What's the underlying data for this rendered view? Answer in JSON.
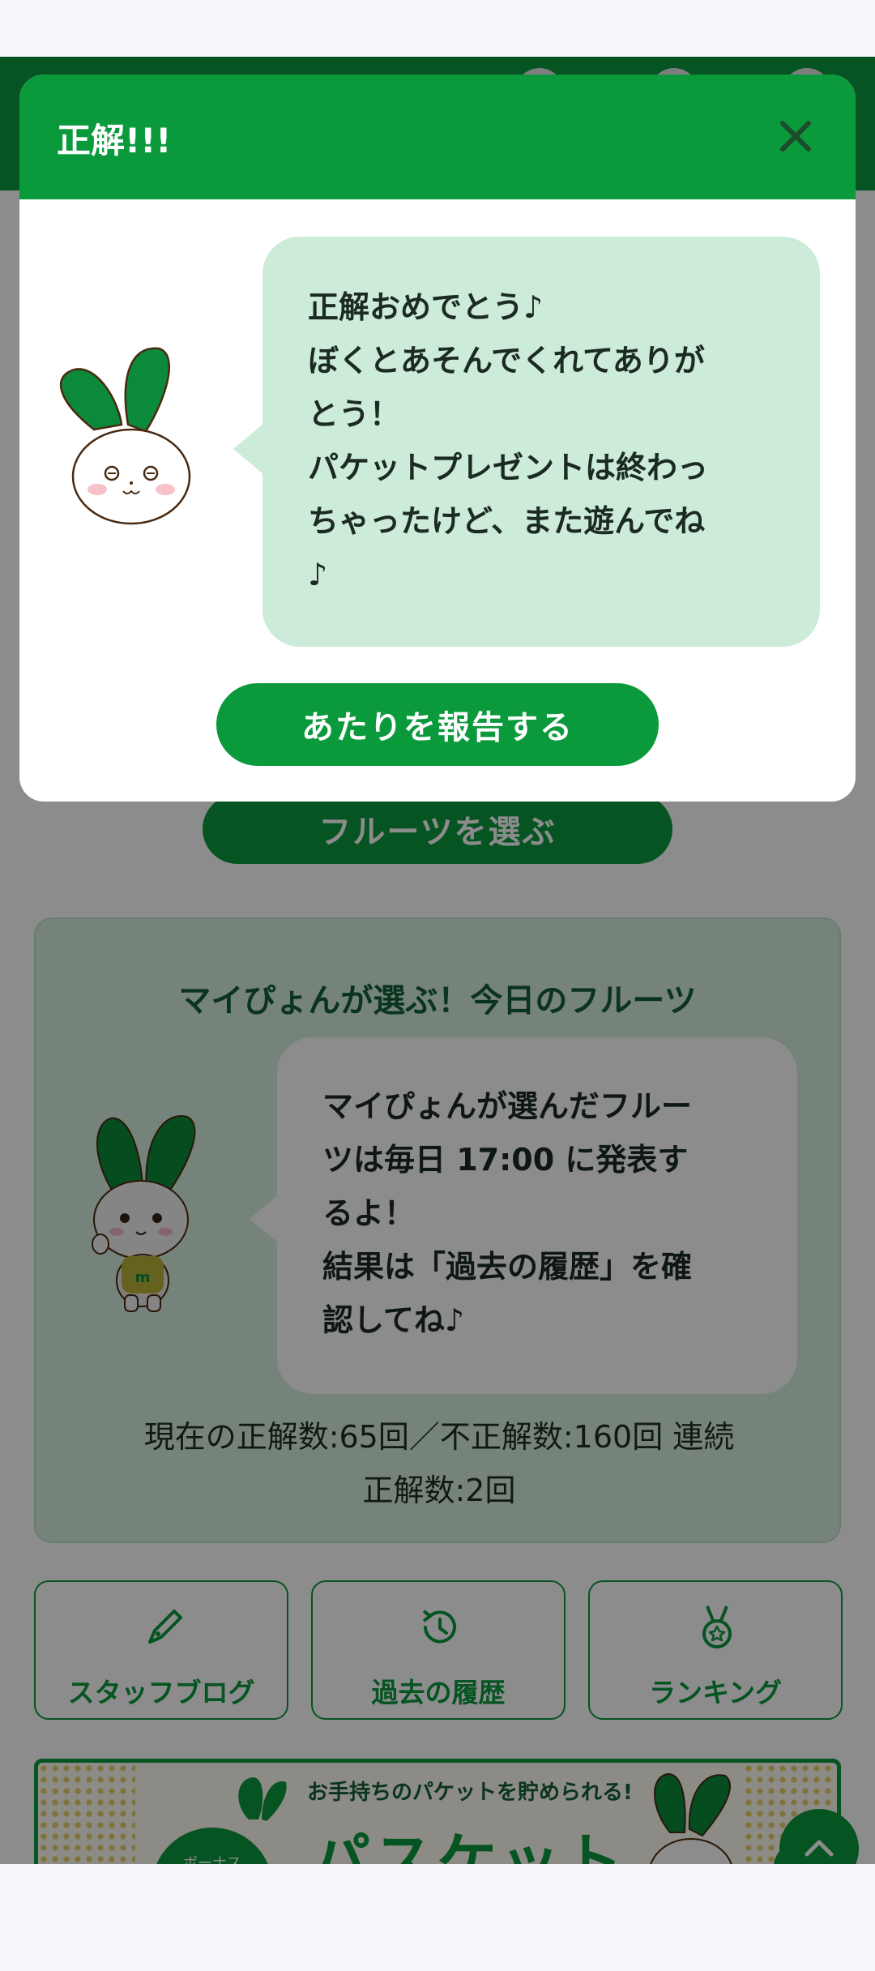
{
  "background_page": {
    "choose_button": "フルーツを選ぶ",
    "pick_card": {
      "title": "マイぴょんが選ぶ！今日のフルーツ",
      "bubble_lines": [
        "マイぴょんが選んだフルー",
        "ツは毎日 17:00 に発表す",
        "るよ！",
        "結果は「過去の履歴」を確",
        "認してね♪"
      ],
      "stats_lines": [
        "現在の正解数:65回／不正解数:160回 連続",
        "正解数:2回"
      ]
    },
    "menu": [
      {
        "label": "スタッフブログ",
        "icon": "pen-icon"
      },
      {
        "label": "過去の履歴",
        "icon": "history-icon"
      },
      {
        "label": "ランキング",
        "icon": "medal-icon"
      }
    ],
    "banner": {
      "subtitle": "お手持ちのパケットを貯められる!",
      "title": "パスケット",
      "bonus_text": "ボーナス"
    }
  },
  "modal": {
    "title": "正解!!!",
    "bubble_lines": [
      "正解おめでとう♪",
      "ぼくとあそんでくれてありが",
      "とう！",
      "パケットプレゼントは終わっ",
      "ちゃったけど、また遊んでね",
      "♪"
    ],
    "report_button": "あたりを報告する"
  },
  "colors": {
    "brand_green": "#0a9a3c",
    "bubble_green": "#cdebd9",
    "overlay": "rgba(0,0,0,0.45)"
  }
}
